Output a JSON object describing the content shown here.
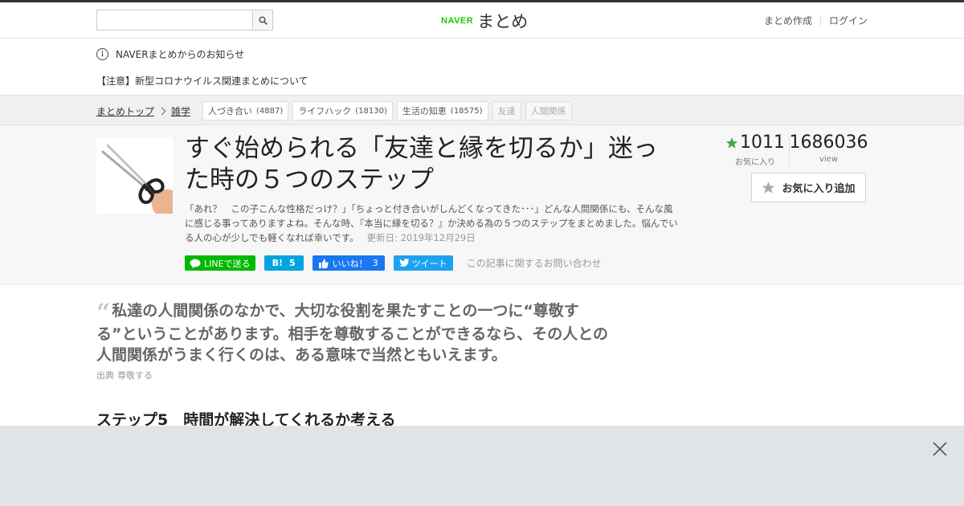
{
  "header": {
    "search_placeholder": "",
    "logo_brand": "NAVER",
    "logo_text": "まとめ",
    "create_link": "まとめ作成",
    "login_link": "ログイン"
  },
  "notice": {
    "title": "NAVERまとめからのお知らせ",
    "item": "【注意】新型コロナウイルス関連まとめについて"
  },
  "breadcrumb": {
    "items": [
      "まとめトップ",
      "雑学"
    ],
    "tags": [
      {
        "label": "人づき合い",
        "count": "(4887)"
      },
      {
        "label": "ライフハック",
        "count": "(18130)"
      },
      {
        "label": "生活の知恵",
        "count": "(18575)"
      },
      {
        "label": "友達",
        "count": ""
      },
      {
        "label": "人間関係",
        "count": ""
      }
    ]
  },
  "article": {
    "title": "すぐ始められる「友達と縁を切るか」迷った時の５つのステップ",
    "description": "「あれ？　この子こんな性格だっけ？」「ちょっと付き合いがしんどくなってきた･･･」どんな人間関係にも、そんな風に感じる事ってありますよね。そんな時、『本当に縁を切る？』か決める為の５つのステップをまとめました。悩んでいる人の心が少しでも軽くなれば幸いです。",
    "updated": "更新日: 2019年12月29日",
    "favorites": "1011",
    "favorites_label": "お気に入り",
    "views": "1686036",
    "views_label": "view",
    "fav_button": "お気に入り追加"
  },
  "share": {
    "line": "LINEで送る",
    "hatena_count": "5",
    "fb_label": "いいね！",
    "fb_count": "3",
    "tweet": "ツイート",
    "inquiry": "この記事に関するお問い合わせ"
  },
  "content": {
    "quote": "私達の人間関係のなかで、大切な役割を果たすことの一つに“尊敬する”ということがあります。相手を尊敬することができるなら、その人との人間関係がうまく行くのは、ある意味で当然ともいえます。",
    "source_label": "出典",
    "source_name": "尊敬する",
    "heading": "ステップ5　時間が解決してくれるか考える"
  },
  "colors": {
    "brand_green": "#1ec800",
    "line_green": "#00b900",
    "hatena_blue": "#00a4de",
    "facebook_blue": "#1877f2",
    "twitter_blue": "#1da1f2",
    "star_green": "#44a94f"
  }
}
